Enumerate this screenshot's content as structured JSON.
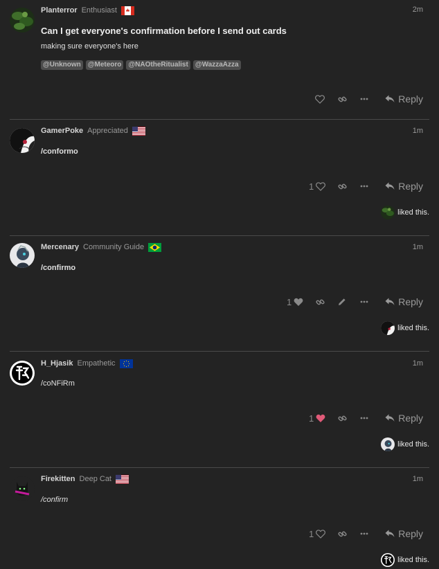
{
  "posts": [
    {
      "username": "Planterror",
      "user_title": "Enthusiast",
      "flag": "canada-flag",
      "time": "2m",
      "title": "Can I get everyone's confirmation before I send out cards",
      "body": "making sure everyone's here",
      "mentions": [
        "@Unknown",
        "@Meteoro",
        "@NAOtheRitualist",
        "@WazzaAzza"
      ],
      "like_count": "",
      "reply_label": "Reply"
    },
    {
      "username": "GamerPoke",
      "user_title": "Appreciated",
      "flag": "usa-flag",
      "time": "1m",
      "body": "/conformo",
      "like_count": "1",
      "reply_label": "Reply",
      "liked_text": "liked this."
    },
    {
      "username": "Mercenary",
      "user_title": "Community Guide",
      "flag": "brazil-flag",
      "time": "1m",
      "body": "/confirmo",
      "like_count": "1",
      "reply_label": "Reply",
      "liked_text": "liked this."
    },
    {
      "username": "H_Hjasik",
      "user_title": "Empathetic",
      "flag": "eu-flag",
      "time": "1m",
      "body": "/coNFiRm",
      "like_count": "1",
      "reply_label": "Reply",
      "liked_text": "liked this."
    },
    {
      "username": "Firekitten",
      "user_title": "Deep Cat",
      "flag": "usa-flag",
      "time": "1m",
      "body": "/confirm",
      "like_count": "1",
      "reply_label": "Reply",
      "liked_text": "liked this."
    }
  ],
  "colors": {
    "background": "#232323",
    "liked_heart": "#e05a78",
    "divider": "#4a4a4a"
  }
}
